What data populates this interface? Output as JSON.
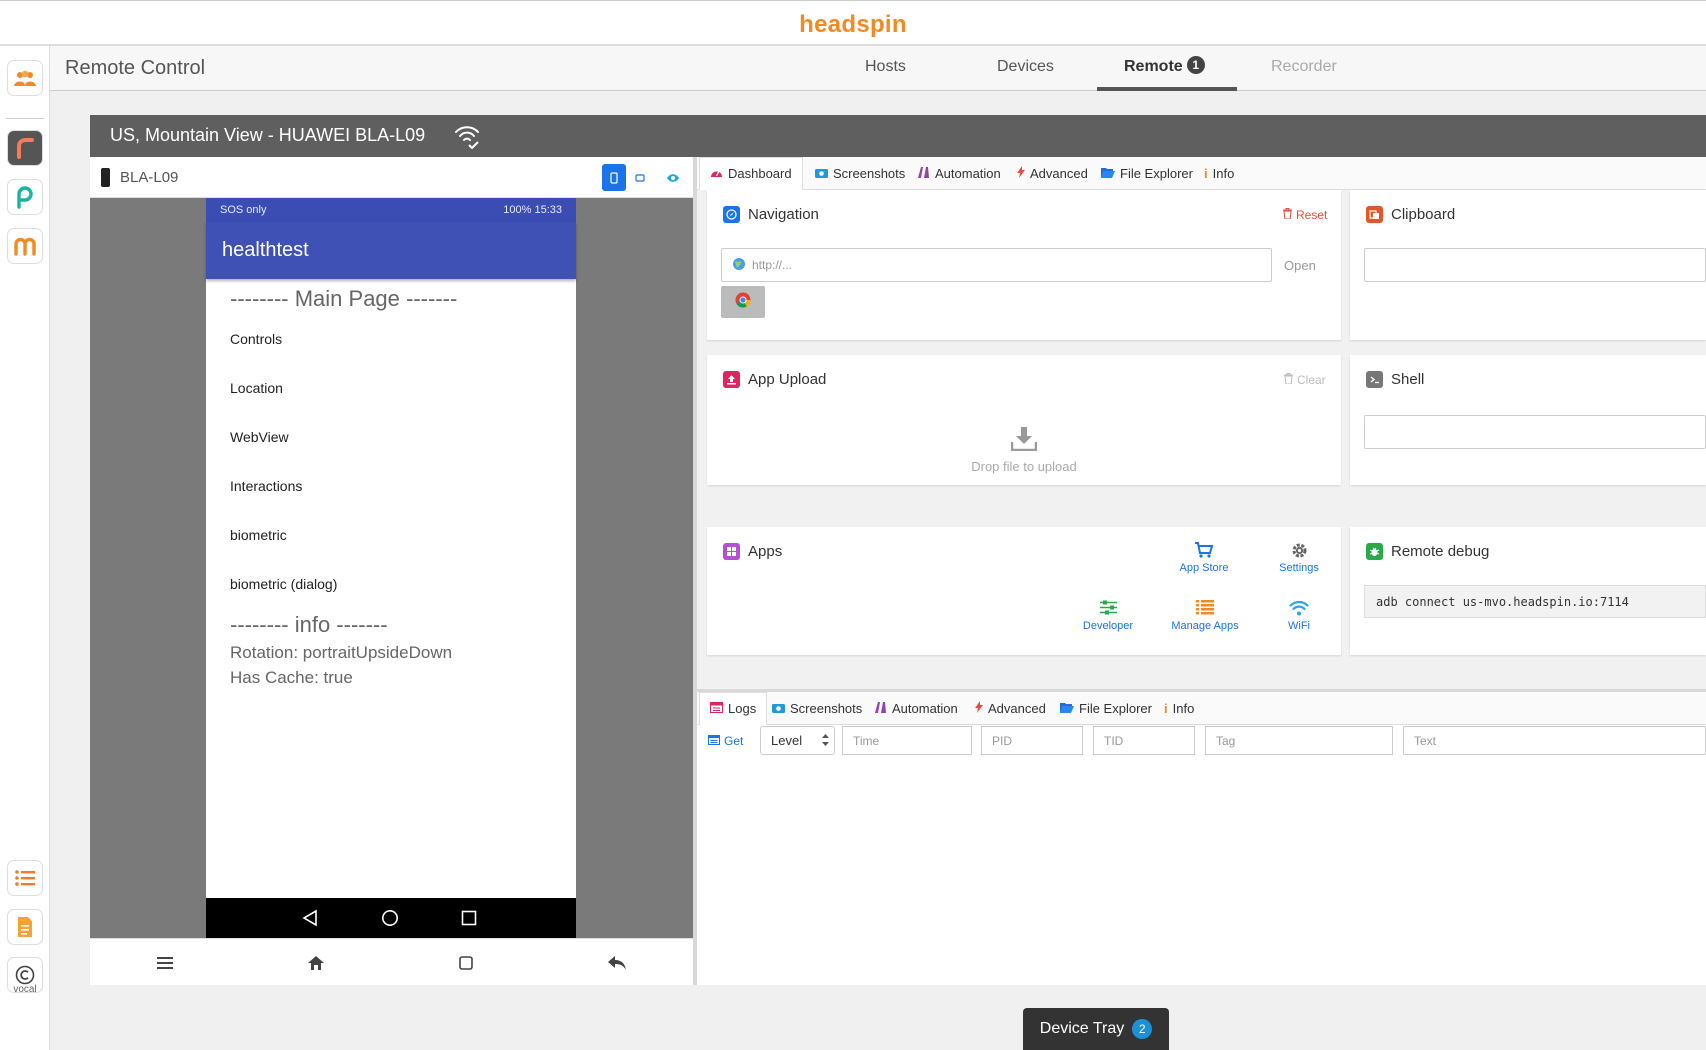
{
  "brand": "headspin",
  "rail": {
    "vocal_label": "vocal"
  },
  "header": {
    "title": "Remote Control",
    "tabs": [
      {
        "label": "Hosts"
      },
      {
        "label": "Devices"
      },
      {
        "label": "Remote",
        "badge": "1"
      },
      {
        "label": "Recorder"
      }
    ]
  },
  "device_panel": {
    "location_title": "US, Mountain View - HUAWEI BLA-L09",
    "device_name": "BLA-L09"
  },
  "phone": {
    "status_left": "SOS only",
    "status_right": "100%  15:33",
    "app_title": "healthtest",
    "main_heading": "-------- Main Page -------",
    "menu_items": [
      "Controls",
      "Location",
      "WebView",
      "Interactions",
      "biometric",
      "biometric (dialog)"
    ],
    "info_heading": "-------- info -------",
    "rotation": "Rotation: portraitUpsideDown",
    "cache": "Has Cache: true"
  },
  "dashboard_tabs": [
    "Dashboard",
    "Screenshots",
    "Automation",
    "Advanced",
    "File Explorer",
    "Info"
  ],
  "navigation": {
    "title": "Navigation",
    "reset_label": "Reset",
    "url_placeholder": "http://...",
    "open_label": "Open"
  },
  "clipboard": {
    "title": "Clipboard"
  },
  "app_upload": {
    "title": "App Upload",
    "clear_label": "Clear",
    "drop_label": "Drop file to upload"
  },
  "shell": {
    "title": "Shell"
  },
  "apps": {
    "title": "Apps",
    "shortcuts": [
      "App Store",
      "Settings",
      "Developer",
      "Manage Apps",
      "WiFi"
    ]
  },
  "remote_debug": {
    "title": "Remote debug",
    "command": "adb connect us-mvo.headspin.io:7114"
  },
  "log_tabs": [
    "Logs",
    "Screenshots",
    "Automation",
    "Advanced",
    "File Explorer",
    "Info"
  ],
  "log_filters": {
    "get_label": "Get",
    "level_value": "Level",
    "time_placeholder": "Time",
    "pid_placeholder": "PID",
    "tid_placeholder": "TID",
    "tag_placeholder": "Tag",
    "text_placeholder": "Text"
  },
  "device_tray": {
    "label": "Device Tray",
    "badge": "2"
  }
}
